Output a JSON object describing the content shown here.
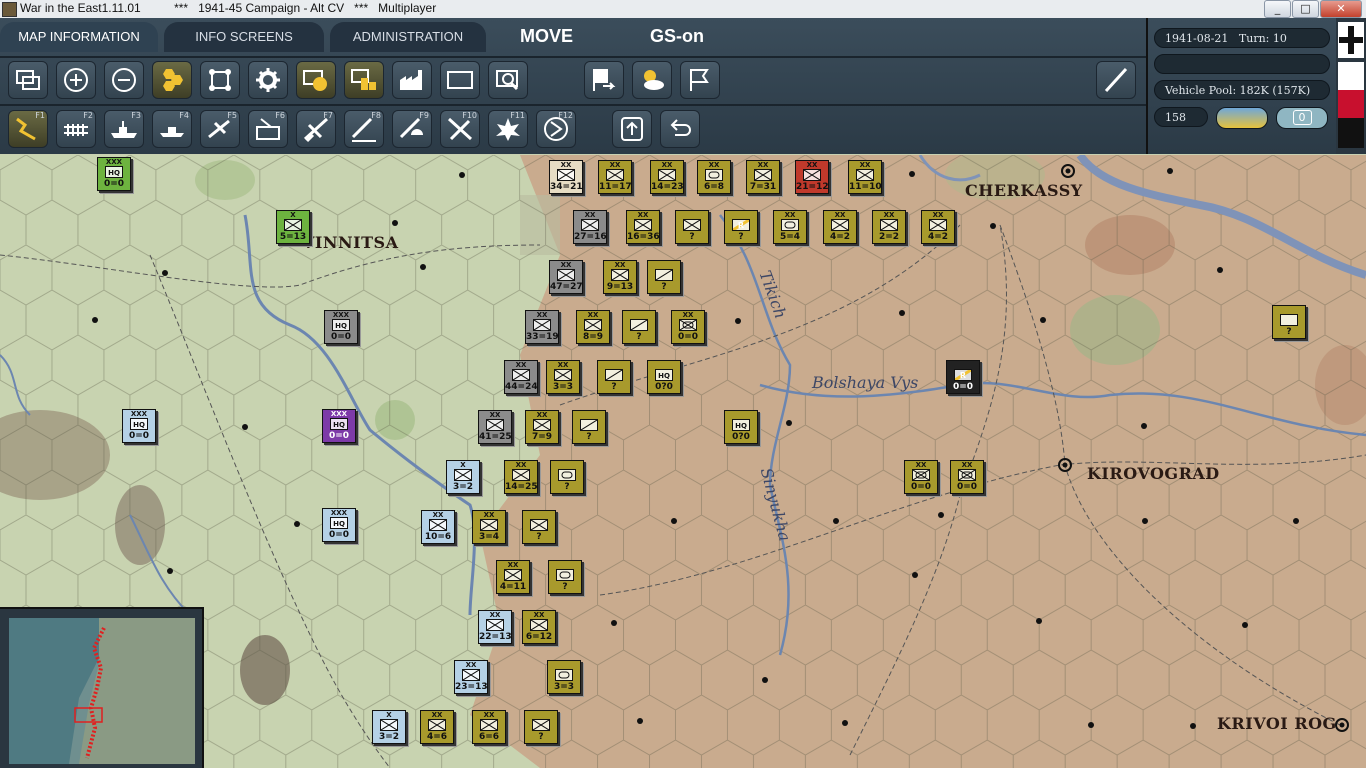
{
  "window": {
    "title": "War in the East1.11.01          ***   1941-45 Campaign - Alt CV   ***   Multiplayer",
    "min": "_",
    "max": "□",
    "close": "✕"
  },
  "tabs": [
    "MAP INFORMATION",
    "INFO SCREENS",
    "ADMINISTRATION"
  ],
  "mode": {
    "move": "MOVE",
    "gs": "GS-on"
  },
  "toolbar_row1_icons": [
    "overlay-icon",
    "zoom-in-icon",
    "zoom-out-icon",
    "hex-icon",
    "frame-icon",
    "gear-icon",
    "unit-highlight-icon",
    "stack-icon",
    "factory-icon",
    "rectangle-icon",
    "magnify-icon",
    "flag-arrow-icon",
    "weather-icon",
    "flag-icon",
    "slash-icon"
  ],
  "toolbar_row2": {
    "fkeys": [
      "F1",
      "F2",
      "F3",
      "F4",
      "F5",
      "F6",
      "F7",
      "F8",
      "F9",
      "F10",
      "F11",
      "F12"
    ]
  },
  "info": {
    "date": "1941-08-21",
    "turn": "Turn: 10",
    "blank": "",
    "vehicle_pool": "Vehicle Pool: 182K (157K)",
    "num": "158",
    "zero": "0"
  },
  "cities": [
    "VINNITSA",
    "CHERKASSY",
    "KIROVOGRAD",
    "KRIVOI ROG"
  ],
  "rivers": [
    "Tikich",
    "Bolshaya Vys",
    "Sinyukha"
  ],
  "counters": [
    {
      "k": "c-grn",
      "sz": "XXX",
      "sym": "HQ",
      "v": "0=0"
    },
    {
      "k": "c-grn",
      "sz": "X",
      "sym": "inf",
      "v": "5=13"
    },
    {
      "k": "c-sov-d",
      "sz": "XXX",
      "sym": "HQ",
      "v": "0=0"
    },
    {
      "k": "c-sov-b",
      "sz": "XXX",
      "sym": "HQ",
      "v": "0=0"
    },
    {
      "k": "c-sov-p",
      "sz": "XXX",
      "sym": "HQ",
      "v": "0=0"
    },
    {
      "k": "c-sov-b",
      "sz": "XXX",
      "sym": "HQ",
      "v": "0=0"
    },
    {
      "k": "c-cream",
      "sz": "XX",
      "sym": "inf",
      "v": "34=21"
    },
    {
      "k": "c-ger",
      "sz": "XX",
      "sym": "inf",
      "v": "11=17"
    },
    {
      "k": "c-ger",
      "sz": "XX",
      "sym": "inf",
      "v": "14=23"
    },
    {
      "k": "c-ger",
      "sz": "XX",
      "sym": "arm",
      "v": "6=8"
    },
    {
      "k": "c-ger",
      "sz": "XX",
      "sym": "inf",
      "v": "7=31"
    },
    {
      "k": "c-red",
      "sz": "XX",
      "sym": "inf",
      "v": "21=12"
    },
    {
      "k": "c-ger",
      "sz": "XX",
      "sym": "inf",
      "v": "11=10"
    },
    {
      "k": "c-sov-d",
      "sz": "XX",
      "sym": "inf",
      "v": "27=16"
    },
    {
      "k": "c-ger",
      "sz": "XX",
      "sym": "inf",
      "v": "16=36"
    },
    {
      "k": "c-ger",
      "sz": "",
      "sym": "inf",
      "v": "?"
    },
    {
      "k": "c-ger",
      "sz": "",
      "sym": "R",
      "v": "?"
    },
    {
      "k": "c-ger",
      "sz": "XX",
      "sym": "arm",
      "v": "5=4"
    },
    {
      "k": "c-ger",
      "sz": "XX",
      "sym": "inf",
      "v": "4=2"
    },
    {
      "k": "c-ger",
      "sz": "XX",
      "sym": "inf",
      "v": "2=2"
    },
    {
      "k": "c-ger",
      "sz": "XX",
      "sym": "inf",
      "v": "4=2"
    },
    {
      "k": "c-sov-d",
      "sz": "XX",
      "sym": "inf",
      "v": "47=27"
    },
    {
      "k": "c-ger",
      "sz": "XX",
      "sym": "inf",
      "v": "9=13"
    },
    {
      "k": "c-ger",
      "sz": "",
      "sym": "slash",
      "v": "?"
    },
    {
      "k": "c-sov-d",
      "sz": "XX",
      "sym": "inf",
      "v": "33=19"
    },
    {
      "k": "c-ger",
      "sz": "XX",
      "sym": "inf",
      "v": "8=9"
    },
    {
      "k": "c-ger",
      "sz": "",
      "sym": "slash",
      "v": "?"
    },
    {
      "k": "c-ger",
      "sz": "XX",
      "sym": "mot",
      "v": "0=0"
    },
    {
      "k": "c-sov-d",
      "sz": "XX",
      "sym": "inf",
      "v": "44=24"
    },
    {
      "k": "c-ger",
      "sz": "XX",
      "sym": "inf",
      "v": "3=3"
    },
    {
      "k": "c-ger",
      "sz": "",
      "sym": "slash",
      "v": "?"
    },
    {
      "k": "c-ger",
      "sz": "",
      "sym": "HQ",
      "v": "0?0"
    },
    {
      "k": "c-blk",
      "sz": "",
      "sym": "R",
      "v": "0=0"
    },
    {
      "k": "c-sov-d",
      "sz": "XX",
      "sym": "inf",
      "v": "41=25"
    },
    {
      "k": "c-ger",
      "sz": "XX",
      "sym": "inf",
      "v": "7=9"
    },
    {
      "k": "c-ger",
      "sz": "",
      "sym": "slash",
      "v": "?"
    },
    {
      "k": "c-ger",
      "sz": "",
      "sym": "HQ",
      "v": "0?0"
    },
    {
      "k": "c-sov-b",
      "sz": "X",
      "sym": "inf",
      "v": "3=2"
    },
    {
      "k": "c-ger",
      "sz": "XX",
      "sym": "inf",
      "v": "14=25"
    },
    {
      "k": "c-ger",
      "sz": "",
      "sym": "arm",
      "v": "?"
    },
    {
      "k": "c-ger",
      "sz": "XX",
      "sym": "mot",
      "v": "0=0"
    },
    {
      "k": "c-ger",
      "sz": "XX",
      "sym": "mot",
      "v": "0=0"
    },
    {
      "k": "c-sov-b",
      "sz": "XX",
      "sym": "inf",
      "v": "10=6"
    },
    {
      "k": "c-ger",
      "sz": "XX",
      "sym": "inf",
      "v": "3=4"
    },
    {
      "k": "c-ger",
      "sz": "",
      "sym": "inf",
      "v": "?"
    },
    {
      "k": "c-ger",
      "sz": "XX",
      "sym": "inf",
      "v": "4=11"
    },
    {
      "k": "c-ger",
      "sz": "",
      "sym": "arm",
      "v": "?"
    },
    {
      "k": "c-ger",
      "sz": "",
      "sym": "white",
      "v": "?"
    },
    {
      "k": "c-sov-b",
      "sz": "XX",
      "sym": "inf",
      "v": "22=13"
    },
    {
      "k": "c-ger",
      "sz": "XX",
      "sym": "inf",
      "v": "6=12"
    },
    {
      "k": "c-sov-b",
      "sz": "XX",
      "sym": "inf",
      "v": "23=13"
    },
    {
      "k": "c-ger",
      "sz": "",
      "sym": "arm",
      "v": "3=3"
    },
    {
      "k": "c-sov-b",
      "sz": "X",
      "sym": "inf",
      "v": "3=2"
    },
    {
      "k": "c-ger",
      "sz": "XX",
      "sym": "inf",
      "v": "4=6"
    },
    {
      "k": "c-ger",
      "sz": "XX",
      "sym": "inf",
      "v": "6=6"
    },
    {
      "k": "c-ger",
      "sz": "",
      "sym": "inf",
      "v": "?"
    }
  ]
}
